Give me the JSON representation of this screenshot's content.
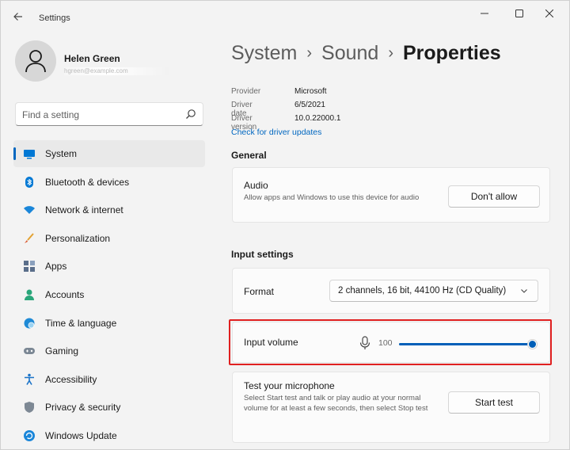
{
  "window": {
    "title": "Settings"
  },
  "user": {
    "name": "Helen Green",
    "email": "hgreen@example.com"
  },
  "search": {
    "placeholder": "Find a setting"
  },
  "colors": {
    "accent": "#0067c0",
    "highlight": "#e02020"
  },
  "sidebar": {
    "items": [
      {
        "label": "System",
        "icon": "system-icon",
        "active": true
      },
      {
        "label": "Bluetooth & devices",
        "icon": "bluetooth-icon"
      },
      {
        "label": "Network & internet",
        "icon": "wifi-icon"
      },
      {
        "label": "Personalization",
        "icon": "brush-icon"
      },
      {
        "label": "Apps",
        "icon": "apps-icon"
      },
      {
        "label": "Accounts",
        "icon": "person-icon"
      },
      {
        "label": "Time & language",
        "icon": "globe-clock-icon"
      },
      {
        "label": "Gaming",
        "icon": "gamepad-icon"
      },
      {
        "label": "Accessibility",
        "icon": "accessibility-icon"
      },
      {
        "label": "Privacy & security",
        "icon": "shield-icon"
      },
      {
        "label": "Windows Update",
        "icon": "update-icon"
      }
    ]
  },
  "breadcrumb": {
    "items": [
      "System",
      "Sound"
    ],
    "current": "Properties"
  },
  "properties": [
    {
      "label": "Provider",
      "value": "Microsoft"
    },
    {
      "label": "Driver date",
      "value": "6/5/2021"
    },
    {
      "label": "Driver version",
      "value": "10.0.22000.1"
    }
  ],
  "driver_link": "Check for driver updates",
  "general": {
    "title": "General",
    "audio": {
      "title": "Audio",
      "description": "Allow apps and Windows to use this device for audio",
      "button": "Don't allow"
    }
  },
  "input_settings": {
    "title": "Input settings",
    "format": {
      "label": "Format",
      "value": "2 channels, 16 bit, 44100 Hz (CD Quality)"
    },
    "volume": {
      "label": "Input volume",
      "value": "100",
      "level": 100
    },
    "test": {
      "title": "Test your microphone",
      "description": "Select Start test and talk or play audio at your normal volume for at least a few seconds, then select Stop test",
      "button": "Start test"
    }
  }
}
